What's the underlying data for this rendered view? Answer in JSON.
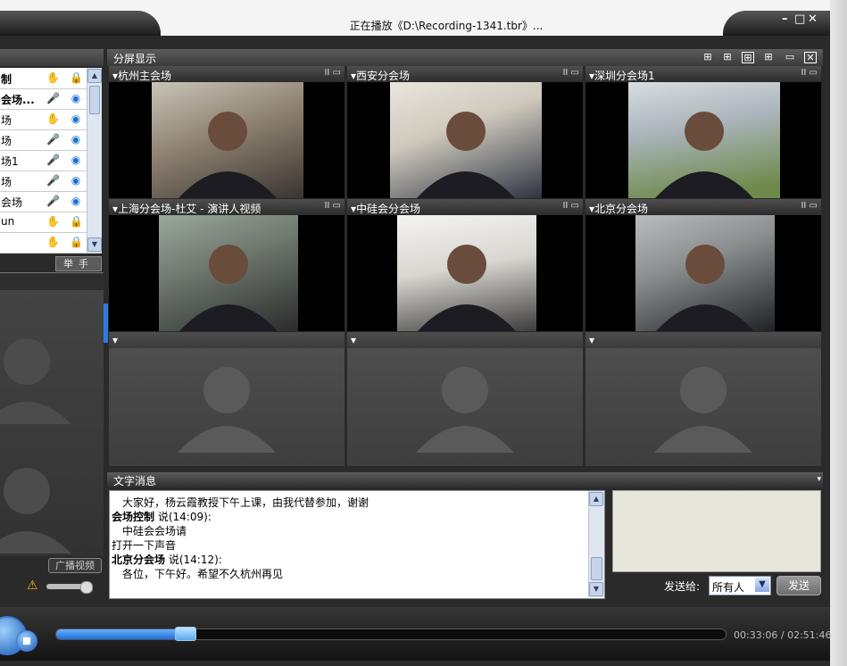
{
  "window": {
    "title": "正在播放《D:\\Recording-1341.tbr》...",
    "minimize": "–",
    "maximize": "□",
    "close": "✕"
  },
  "participants": {
    "rows": [
      {
        "name": "制",
        "bold": true,
        "icon1": "hand-icon",
        "icon2": "lock-icon"
      },
      {
        "name": "会场...",
        "bold": true,
        "icon1": "microphone-icon",
        "icon2": "camera-icon"
      },
      {
        "name": "场",
        "bold": false,
        "icon1": "hand-icon",
        "icon2": "camera-icon"
      },
      {
        "name": "场",
        "bold": false,
        "icon1": "microphone-icon",
        "icon2": "camera-icon"
      },
      {
        "name": "场1",
        "bold": false,
        "icon1": "microphone-icon",
        "icon2": "camera-icon"
      },
      {
        "name": "场",
        "bold": false,
        "icon1": "microphone-icon",
        "icon2": "camera-icon"
      },
      {
        "name": "会场",
        "bold": false,
        "icon1": "microphone-icon",
        "icon2": "camera-icon"
      },
      {
        "name": "un",
        "bold": false,
        "icon1": "hand-icon",
        "icon2": "lock-icon"
      },
      {
        "name": "",
        "bold": false,
        "icon1": "hand-icon",
        "icon2": "lock-icon"
      }
    ],
    "raise_hand_label": "举手",
    "broadcast_label": "广播视频"
  },
  "split_screen": {
    "label": "分屏显示",
    "layout_icons": [
      "layout-2x2-icon",
      "layout-1plus-icon",
      "layout-3x3-icon",
      "layout-4x4-icon",
      "layout-single-icon",
      "fullscreen-icon"
    ],
    "cells": [
      {
        "title": "▾杭州主会场",
        "active": true
      },
      {
        "title": "▾西安分会场",
        "active": true
      },
      {
        "title": "▾深圳分会场1",
        "active": true
      },
      {
        "title": "▾上海分会场-杜艾 - 演讲人视频",
        "active": true
      },
      {
        "title": "▾中硅会分会场",
        "active": true
      },
      {
        "title": "▾北京分会场",
        "active": true
      },
      {
        "title": "▾",
        "active": false
      },
      {
        "title": "▾",
        "active": false
      },
      {
        "title": "▾",
        "active": false
      }
    ],
    "cell_controls": "II ▭"
  },
  "chat": {
    "label": "文字消息",
    "lines": [
      {
        "text": "　大家好，杨云霞教授下午上课，由我代替参加，谢谢",
        "bold": false
      },
      {
        "text": "会场控制",
        "bold": true,
        "suffix": " 说(14:09):"
      },
      {
        "text": "　中硅会会场请",
        "bold": false
      },
      {
        "text": "打开一下声音",
        "bold": false
      },
      {
        "text": "北京分会场",
        "bold": true,
        "suffix": " 说(14:12):"
      },
      {
        "text": "　各位，下午好。希望不久杭州再见",
        "bold": false
      }
    ],
    "send_to_label": "发送给:",
    "send_to_value": "所有人",
    "send_button": "发送"
  },
  "player": {
    "time": "00:33:06 / 02:51:46",
    "progress": 0.193
  },
  "colors": {
    "accent": "#1f6fd6",
    "panel_dark": "#2a2a2a"
  }
}
